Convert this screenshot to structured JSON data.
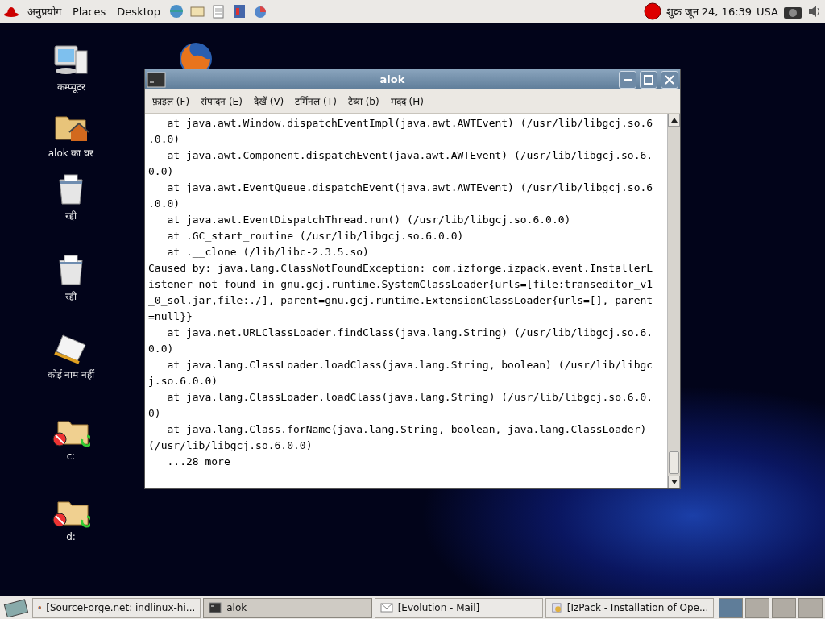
{
  "top_panel": {
    "menus": [
      "अनुप्रयोग",
      "Places",
      "Desktop"
    ],
    "clock": "शुक्र  जून 24, 16:39",
    "keyboard": "USA"
  },
  "desktop_icons": [
    {
      "kind": "computer",
      "label": "कम्प्यूटर"
    },
    {
      "kind": "home",
      "label": "alok का घर"
    },
    {
      "kind": "trash",
      "label": "रद्दी"
    },
    {
      "kind": "trash",
      "label": "रद्दी"
    },
    {
      "kind": "note",
      "label": "कोई नाम नहीं"
    },
    {
      "kind": "drive",
      "label": "c:"
    },
    {
      "kind": "drive",
      "label": "d:"
    }
  ],
  "window": {
    "title": "alok",
    "menu": [
      "फ़ाइल (F)",
      "संपादन (E)",
      "देखें (V)",
      "टर्मिनल (T)",
      "टैब्स (b)",
      "मदद (H)"
    ],
    "lines": [
      "   at java.awt.Window.dispatchEventImpl(java.awt.AWTEvent) (/usr/lib/libgcj.so.6",
      ".0.0)",
      "   at java.awt.Component.dispatchEvent(java.awt.AWTEvent) (/usr/lib/libgcj.so.6.",
      "0.0)",
      "   at java.awt.EventQueue.dispatchEvent(java.awt.AWTEvent) (/usr/lib/libgcj.so.6",
      ".0.0)",
      "   at java.awt.EventDispatchThread.run() (/usr/lib/libgcj.so.6.0.0)",
      "   at .GC_start_routine (/usr/lib/libgcj.so.6.0.0)",
      "   at .__clone (/lib/libc-2.3.5.so)",
      "Caused by: java.lang.ClassNotFoundException: com.izforge.izpack.event.InstallerL",
      "istener not found in gnu.gcj.runtime.SystemClassLoader{urls=[file:transeditor_v1",
      "_0_sol.jar,file:./], parent=gnu.gcj.runtime.ExtensionClassLoader{urls=[], parent",
      "=null}}",
      "   at java.net.URLClassLoader.findClass(java.lang.String) (/usr/lib/libgcj.so.6.",
      "0.0)",
      "   at java.lang.ClassLoader.loadClass(java.lang.String, boolean) (/usr/lib/libgc",
      "j.so.6.0.0)",
      "   at java.lang.ClassLoader.loadClass(java.lang.String) (/usr/lib/libgcj.so.6.0.",
      "0)",
      "   at java.lang.Class.forName(java.lang.String, boolean, java.lang.ClassLoader)",
      "(/usr/lib/libgcj.so.6.0.0)",
      "   ...28 more"
    ]
  },
  "taskbar": [
    {
      "kind": "browser",
      "label": "[SourceForge.net: indlinux-hi...",
      "selected": false
    },
    {
      "kind": "terminal",
      "label": "alok",
      "selected": true
    },
    {
      "kind": "mail",
      "label": "[Evolution - Mail]",
      "selected": false
    },
    {
      "kind": "installer",
      "label": "[IzPack - Installation of Ope...",
      "selected": false
    }
  ],
  "workspaces": [
    {
      "selected": true
    },
    {
      "selected": false
    },
    {
      "selected": false
    },
    {
      "selected": false
    }
  ]
}
